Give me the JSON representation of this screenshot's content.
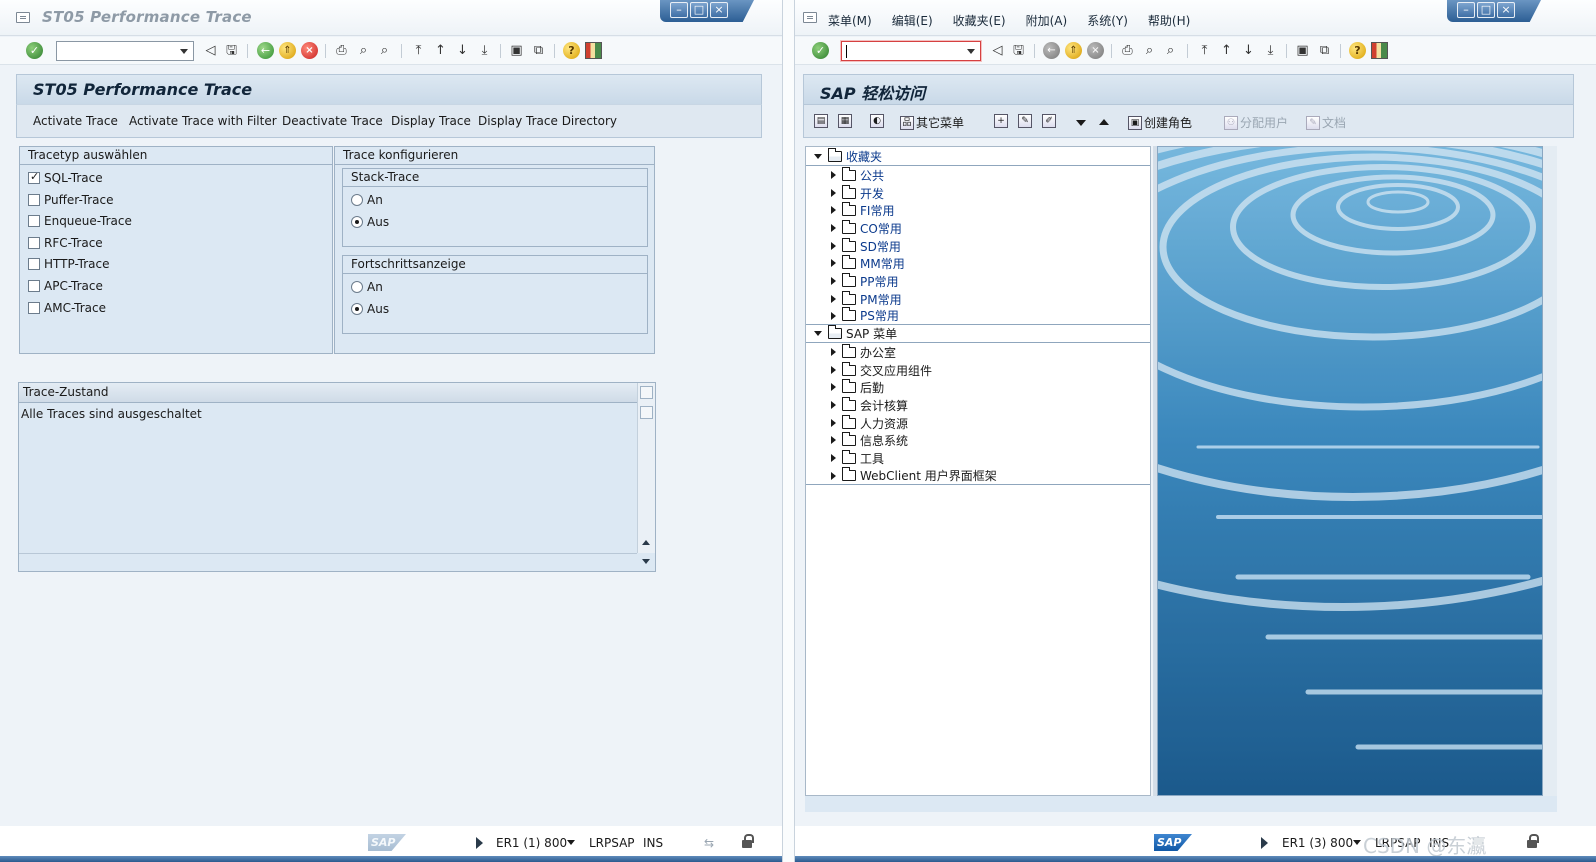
{
  "left_window": {
    "title": "ST05 Performance Trace",
    "window_controls": [
      "–",
      "□",
      "×"
    ],
    "screen_title": "ST05 Performance Trace",
    "app_toolbar": [
      "Activate Trace",
      "Activate Trace with Filter",
      "Deactivate Trace",
      "Display Trace",
      "Display Trace Directory"
    ],
    "trace_types": {
      "title": "Tracetyp auswählen",
      "items": [
        {
          "label": "SQL-Trace",
          "checked": true
        },
        {
          "label": "Puffer-Trace",
          "checked": false
        },
        {
          "label": "Enqueue-Trace",
          "checked": false
        },
        {
          "label": "RFC-Trace",
          "checked": false
        },
        {
          "label": "HTTP-Trace",
          "checked": false
        },
        {
          "label": "APC-Trace",
          "checked": false
        },
        {
          "label": "AMC-Trace",
          "checked": false
        }
      ]
    },
    "configure": {
      "title": "Trace konfigurieren",
      "stack_trace": {
        "title": "Stack-Trace",
        "options": [
          "An",
          "Aus"
        ],
        "selected": "Aus"
      },
      "progress": {
        "title": "Fortschrittsanzeige",
        "options": [
          "An",
          "Aus"
        ],
        "selected": "Aus"
      }
    },
    "status_box": {
      "title": "Trace-Zustand",
      "text": "Alle Traces sind ausgeschaltet"
    },
    "status_bar": {
      "logo": "SAP",
      "system": "ER1 (1) 800",
      "server": "LRPSAP",
      "mode": "INS"
    }
  },
  "right_window": {
    "menu": [
      "菜单(M)",
      "编辑(E)",
      "收藏夹(E)",
      "附加(A)",
      "系统(Y)",
      "帮助(H)"
    ],
    "window_controls": [
      "–",
      "□",
      "×"
    ],
    "screen_title": "SAP 轻松访问",
    "toolbar": {
      "other_menu": "其它菜单",
      "create_role": "创建角色",
      "assign_users": "分配用户",
      "documentation": "文档"
    },
    "tree": {
      "favorites": {
        "label": "收藏夹",
        "children": [
          "公共",
          "开发",
          "FI常用",
          "CO常用",
          "SD常用",
          "MM常用",
          "PP常用",
          "PM常用",
          "PS常用"
        ]
      },
      "sap_menu": {
        "label": "SAP 菜单",
        "children": [
          "办公室",
          "交叉应用组件",
          "后勤",
          "会计核算",
          "人力资源",
          "信息系统",
          "工具",
          "WebClient 用户界面框架"
        ]
      }
    },
    "status_bar": {
      "logo": "SAP",
      "system": "ER1 (3) 800",
      "server": "LRPSAP",
      "mode": "INS"
    },
    "watermark": "CSDN @东瀛"
  },
  "colors": {
    "accent": "#2c5e94",
    "panel": "#dce8f3",
    "link": "#0b3a8c"
  },
  "icons": [
    "check-icon",
    "back-icon",
    "save-icon",
    "exit-icon",
    "up-icon",
    "cancel-icon",
    "print-icon",
    "find-icon",
    "find-next-icon",
    "first-page-icon",
    "prev-page-icon",
    "next-page-icon",
    "last-page-icon",
    "new-session-icon",
    "shortcut-icon",
    "help-icon",
    "layout-icon",
    "folder-icon"
  ]
}
